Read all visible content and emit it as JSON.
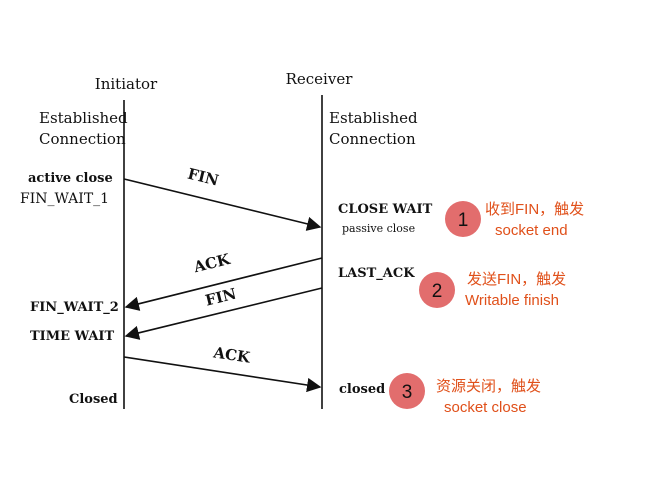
{
  "participants": {
    "initiator": "Initiator",
    "receiver": "Receiver"
  },
  "established": {
    "line1": "Established",
    "line2": "Connection"
  },
  "initiator_states": {
    "active_close": "active close",
    "fin_wait_1": "FIN_WAIT_1",
    "fin_wait_2": "FIN_WAIT_2",
    "time_wait": "TIME WAIT",
    "closed": "Closed"
  },
  "receiver_states": {
    "close_wait": "CLOSE WAIT",
    "passive_close": "passive close",
    "last_ack": "LAST_ACK",
    "closed": "closed"
  },
  "messages": {
    "fin_1": "FIN",
    "ack_1": "ACK",
    "fin_2": "FIN",
    "ack_2": "ACK"
  },
  "annotations": [
    {
      "number": "1",
      "line1": "收到FIN，触发",
      "line2": "socket end"
    },
    {
      "number": "2",
      "line1": "发送FIN，触发",
      "line2": "Writable finish"
    },
    {
      "number": "3",
      "line1": "资源关闭，触发",
      "line2": "socket close"
    }
  ],
  "colors": {
    "badge": "#e26d6d",
    "annotation_text": "#e0501a",
    "line": "#111111"
  }
}
